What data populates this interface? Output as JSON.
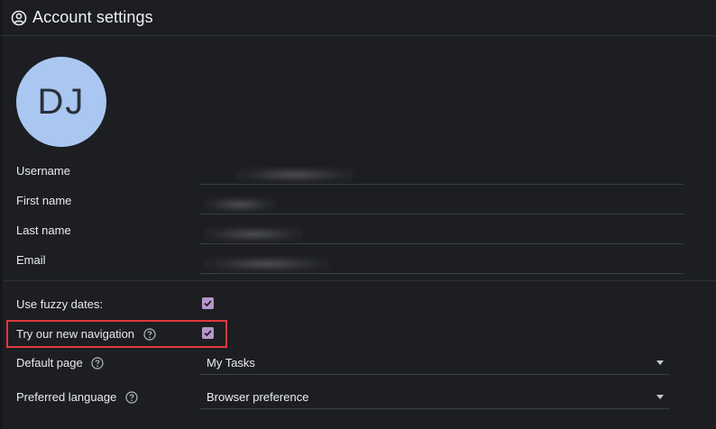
{
  "header": {
    "title": "Account settings",
    "icon": "account-circle-icon"
  },
  "avatar": {
    "initials": "DJ",
    "color": "#a9c7f1"
  },
  "profile": {
    "username_label": "Username",
    "first_name_label": "First name",
    "last_name_label": "Last name",
    "email_label": "Email"
  },
  "preferences": {
    "fuzzy_dates_label": "Use fuzzy dates:",
    "fuzzy_dates_checked": true,
    "new_navigation_label": "Try our new navigation",
    "new_navigation_checked": true,
    "default_page_label": "Default page",
    "default_page_value": "My Tasks",
    "language_label": "Preferred language",
    "language_value": "Browser preference"
  },
  "colors": {
    "background": "#1c1e22",
    "checkbox": "#b796c9",
    "highlight": "#e0393d"
  }
}
